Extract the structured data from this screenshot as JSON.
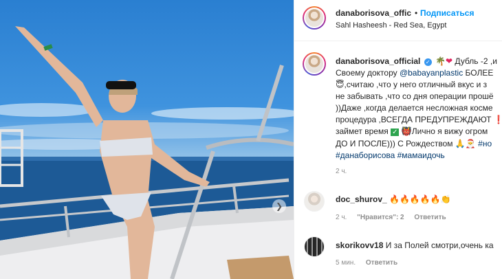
{
  "post": {
    "username": "danaborisova_offic",
    "follow_label": "Подписаться",
    "dot": "•",
    "location": "Sahl Hasheesh - Red Sea, Egypt"
  },
  "caption": {
    "username": "danaborisova_official",
    "line1_rest": "Дубль -2 ,и",
    "line2_text": "Своему доктору",
    "line2_mention": "@babayanplastic",
    "line2_rest": "БОЛЕЕ",
    "line3": ",считаю ,что у него отличный вкус и з",
    "line4": "не забывать ,что со дня операции прошё",
    "line5": "))Даже ,когда делается несложная косме",
    "line6": "процедура ,ВСЕГДА ПРЕДУПРЕЖДАЮТ",
    "line7_a": "займет время",
    "line7_b": "Лично я вижу огром",
    "line8": "ДО И ПОСЛЕ))) С Рождеством",
    "line8_tag": "#но",
    "line9_tags": "#данаборисова #мамаидочь",
    "time": "2 ч."
  },
  "comments": [
    {
      "username": "doc_shurov_",
      "text": "🔥🔥🔥🔥🔥👏",
      "time": "2 ч.",
      "likes": "\"Нравится\": 2",
      "reply": "Ответить"
    },
    {
      "username": "skorikovv18",
      "text": "И за Полей смотри,очень ка",
      "time": "5 мин.",
      "reply": "Ответить"
    }
  ],
  "icons": {
    "carousel_next": "chevron-right-icon",
    "verified": "verified-badge-icon"
  },
  "colors": {
    "link": "#0095f6",
    "mention": "#00376b",
    "verified": "#3897f0"
  }
}
